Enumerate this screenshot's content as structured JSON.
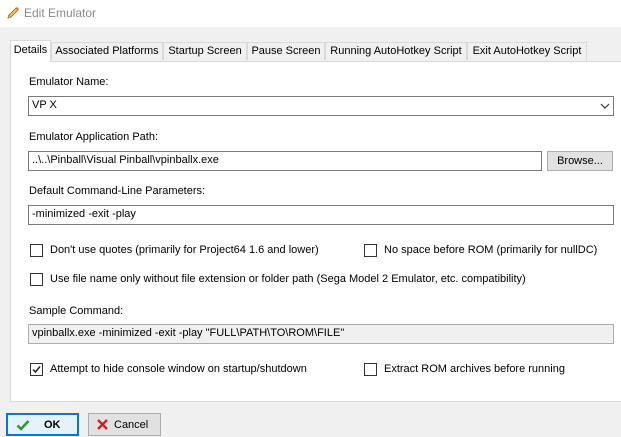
{
  "window": {
    "title": "Edit Emulator",
    "title_icon": "pencil-icon"
  },
  "tabs": [
    {
      "label": "Details",
      "active": true
    },
    {
      "label": "Associated Platforms",
      "active": false
    },
    {
      "label": "Startup Screen",
      "active": false
    },
    {
      "label": "Pause Screen",
      "active": false
    },
    {
      "label": "Running AutoHotkey Script",
      "active": false
    },
    {
      "label": "Exit AutoHotkey Script",
      "active": false
    }
  ],
  "details": {
    "emulator_name_label": "Emulator Name:",
    "emulator_name_value": "VP X",
    "app_path_label": "Emulator Application Path:",
    "app_path_value": "..\\..\\Pinball\\Visual Pinball\\vpinballx.exe",
    "browse_label": "Browse...",
    "cmdline_label": "Default Command-Line Parameters:",
    "cmdline_value": "-minimized -exit -play",
    "no_quotes_label": "Don't use quotes (primarily for Project64 1.6 and lower)",
    "no_quotes_checked": false,
    "no_space_label": "No space before ROM (primarily for nullDC)",
    "no_space_checked": false,
    "filename_only_label": "Use file name only without file extension or folder path (Sega Model 2 Emulator, etc. compatibility)",
    "filename_only_checked": false,
    "sample_label": "Sample Command:",
    "sample_value": "vpinballx.exe -minimized -exit -play \"FULL\\PATH\\TO\\ROM\\FILE\"",
    "hide_console_label": "Attempt to hide console window on startup/shutdown",
    "hide_console_checked": true,
    "extract_label": "Extract ROM archives before running",
    "extract_checked": false
  },
  "footer": {
    "ok_label": "OK",
    "ok_icon": "checkmark-icon",
    "cancel_label": "Cancel",
    "cancel_icon": "red-x-icon"
  },
  "colors": {
    "ok_check": "#2e9a2e",
    "cancel_x": "#d42020",
    "focus_border": "#0078d7"
  }
}
